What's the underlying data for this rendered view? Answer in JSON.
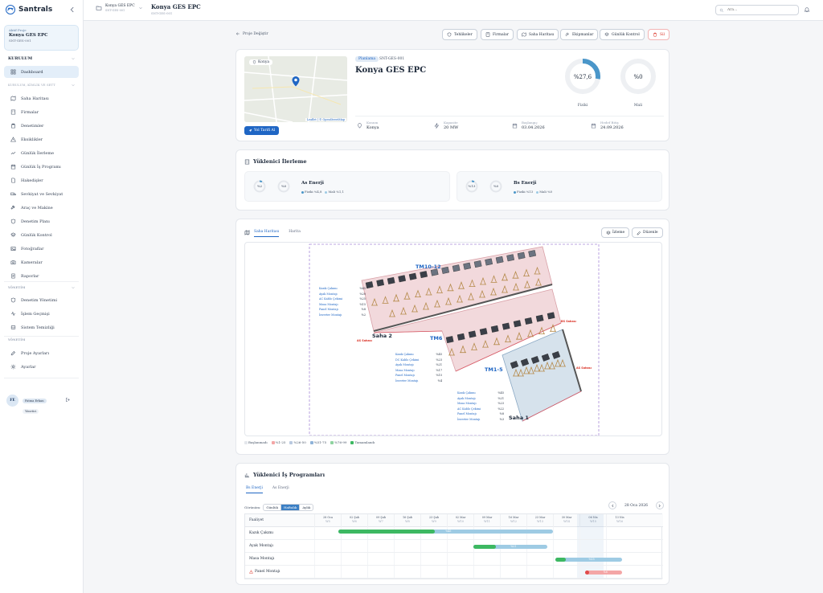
{
  "brand": {
    "name": "Santrals",
    "accent": "#1f66c4"
  },
  "sidebar": {
    "active_label": "Aktif Proje",
    "active_name": "Konya GES EPC",
    "active_code": "SNT-GES-001",
    "section_kurulum": "KURULUM",
    "dashboard": "Dashboard",
    "section_sub": "KURULUM, KİMLİK VE SETT",
    "items": [
      "Saha Haritası",
      "Firmalar",
      "Denetimler",
      "Eksiklikler",
      "Günlük İlerleme",
      "Günlük İş Programı",
      "Hakedişler",
      "Sevkiyat ve Sevkiyat",
      "Araç ve Makine",
      "Denetim Planı",
      "Günlük Kontrol",
      "Fotoğraflar",
      "Kameralar",
      "Raporlar"
    ],
    "section_yonetim": "YÖNETİM",
    "yonetim_items": [
      "Denetim Yönetimi",
      "İşlem Geçmişi",
      "Sistem Temizliği"
    ],
    "section_yonetim2": "YÖNETİM",
    "extra_items": [
      "Proje Ayarları",
      "Ayarlar"
    ],
    "user_initials": "FE",
    "user_name": "Fatma Erkan",
    "user_role": "Yönetici"
  },
  "topbar": {
    "switch_name": "Konya GES EPC",
    "switch_code": "SNT-GES-001",
    "title": "Konya GES EPC",
    "code": "SNT-GES-001",
    "search_placeholder": "Ara..."
  },
  "header": {
    "back": "Proje Değiştir",
    "actions": [
      "Tehlikeler",
      "Firmalar",
      "Saha Haritası",
      "Ekipmanlar",
      "Günlük Kontrol",
      "Sil"
    ]
  },
  "project": {
    "map_chip": "Konya",
    "map_attr": "Leaflet | © OpenStreetMap",
    "directions": "Yol Tarifi Al",
    "status": "Planlama",
    "code": "SNT-GES-001",
    "name": "Konya GES EPC",
    "physical_pct": 27.6,
    "physical_label": "%27,6",
    "physical_title": "Fiziki",
    "financial_pct": 0,
    "financial_label": "%0",
    "financial_title": "Mali",
    "stats": [
      {
        "k": "Konum",
        "v": "Konya",
        "icon": "location-icon"
      },
      {
        "k": "Kapasite",
        "v": "20 MW",
        "icon": "bolt-icon"
      },
      {
        "k": "Başlangıç",
        "v": "03.04.2026",
        "icon": "calendar-icon"
      },
      {
        "k": "Hedef Bitiş",
        "v": "24.09.2026",
        "icon": "calendar-icon"
      }
    ]
  },
  "contractor": {
    "title": "Yüklenici İlerleme",
    "items": [
      {
        "name": "As Enerji",
        "fiziki": "%2",
        "mali": "%0",
        "leg_f": "Fiziki %4,8",
        "leg_m": "Mali %1,1"
      },
      {
        "name": "Bs Enerji",
        "fiziki": "%13",
        "mali": "%0",
        "leg_f": "Fiziki %13",
        "leg_m": "Mali %0"
      }
    ]
  },
  "site": {
    "tabs": [
      "Saha Haritası",
      "Harita"
    ],
    "btn_layers": "İzleme",
    "btn_edit": "Düzenle",
    "labels": {
      "tm1012": "TM10-12",
      "tm6": "TM6",
      "tm15": "TM1-5",
      "saha2": "Saha 2",
      "saha1": "Saha 1",
      "as_sahas": "AS Sahası",
      "bs_sahas": "BS Sahası",
      "as_sahasi": "AS Sahası"
    },
    "list_a": [
      [
        "Kazık Çakımı",
        "%45"
      ],
      [
        "Ayak Montajı",
        "%20"
      ],
      [
        "AC Kablo Çekimi",
        "%25"
      ],
      [
        "Masa Montajı",
        "%15"
      ],
      [
        "Panel Montajı",
        "%8"
      ],
      [
        "İnverter Montajı",
        "%2"
      ]
    ],
    "list_b": [
      [
        "Kazık Çakımı",
        "%45"
      ],
      [
        "DC Kablo Çekimi",
        "%23"
      ],
      [
        "Ayak Montajı",
        "%21"
      ],
      [
        "Masa Montajı",
        "%17"
      ],
      [
        "Panel Montajı",
        "%15"
      ],
      [
        "İnverter Montajı",
        "%4"
      ]
    ],
    "list_c": [
      [
        "Kazık Çakımı",
        "%45"
      ],
      [
        "Ayak Montajı",
        "%21"
      ],
      [
        "Masa Montajı",
        "%23"
      ],
      [
        "AC Kablo Çekimi",
        "%22"
      ],
      [
        "Panel Montajı",
        "%8"
      ],
      [
        "İnverter Montajı",
        "%3"
      ]
    ],
    "legend": [
      {
        "label": "Başlanmadı",
        "color": "#e4e7ec"
      },
      {
        "label": "%1-25",
        "color": "#f4a6a6"
      },
      {
        "label": "%26-50",
        "color": "#b9c9e0"
      },
      {
        "label": "%51-75",
        "color": "#8fb3d9"
      },
      {
        "label": "%76-99",
        "color": "#8fd3a0"
      },
      {
        "label": "Tamamlandı",
        "color": "#3db862"
      }
    ]
  },
  "schedule": {
    "title": "Yüklenici İş Programları",
    "tabs": [
      "Bs Enerji",
      "As Enerji"
    ],
    "view_label": "Görünüm:",
    "views": [
      "Günlük",
      "Haftalık",
      "Aylık"
    ],
    "active_view": "Haftalık",
    "current_date": "28 Oca 2026",
    "activity_header": "Faaliyet",
    "weeks": [
      [
        "28 Oca",
        "W5"
      ],
      [
        "02 Şub",
        "W6"
      ],
      [
        "09 Şub",
        "W7"
      ],
      [
        "16 Şub",
        "W8"
      ],
      [
        "23 Şub",
        "W9"
      ],
      [
        "02 Mar",
        "W10"
      ],
      [
        "09 Mar",
        "W11"
      ],
      [
        "16 Mar",
        "W12"
      ],
      [
        "23 Mar",
        "W13"
      ],
      [
        "30 Mar",
        "W14"
      ],
      [
        "06 Nis",
        "W15"
      ],
      [
        "13 Nis",
        "W16"
      ]
    ],
    "rows": [
      {
        "name": "Kazık Çakımı",
        "start": 0.9,
        "len": 8.1,
        "done": 0.45,
        "color": "#3db862",
        "rest": "#9ecbe4",
        "pct": "%45",
        "warn": false
      },
      {
        "name": "Ayak Montajı",
        "start": 6.0,
        "len": 2.8,
        "done": 0.3,
        "color": "#3db862",
        "rest": "#9ecbe4",
        "pct": "%21",
        "warn": false
      },
      {
        "name": "Masa Montajı",
        "start": 9.1,
        "len": 2.5,
        "done": 0.15,
        "color": "#3db862",
        "rest": "#9ecbe4",
        "pct": "%15",
        "warn": false
      },
      {
        "name": "Panel Montajı",
        "start": 10.2,
        "len": 1.4,
        "done": 0.12,
        "color": "#e04b4b",
        "rest": "#f4a6a6",
        "pct": "%8",
        "warn": true
      }
    ]
  }
}
